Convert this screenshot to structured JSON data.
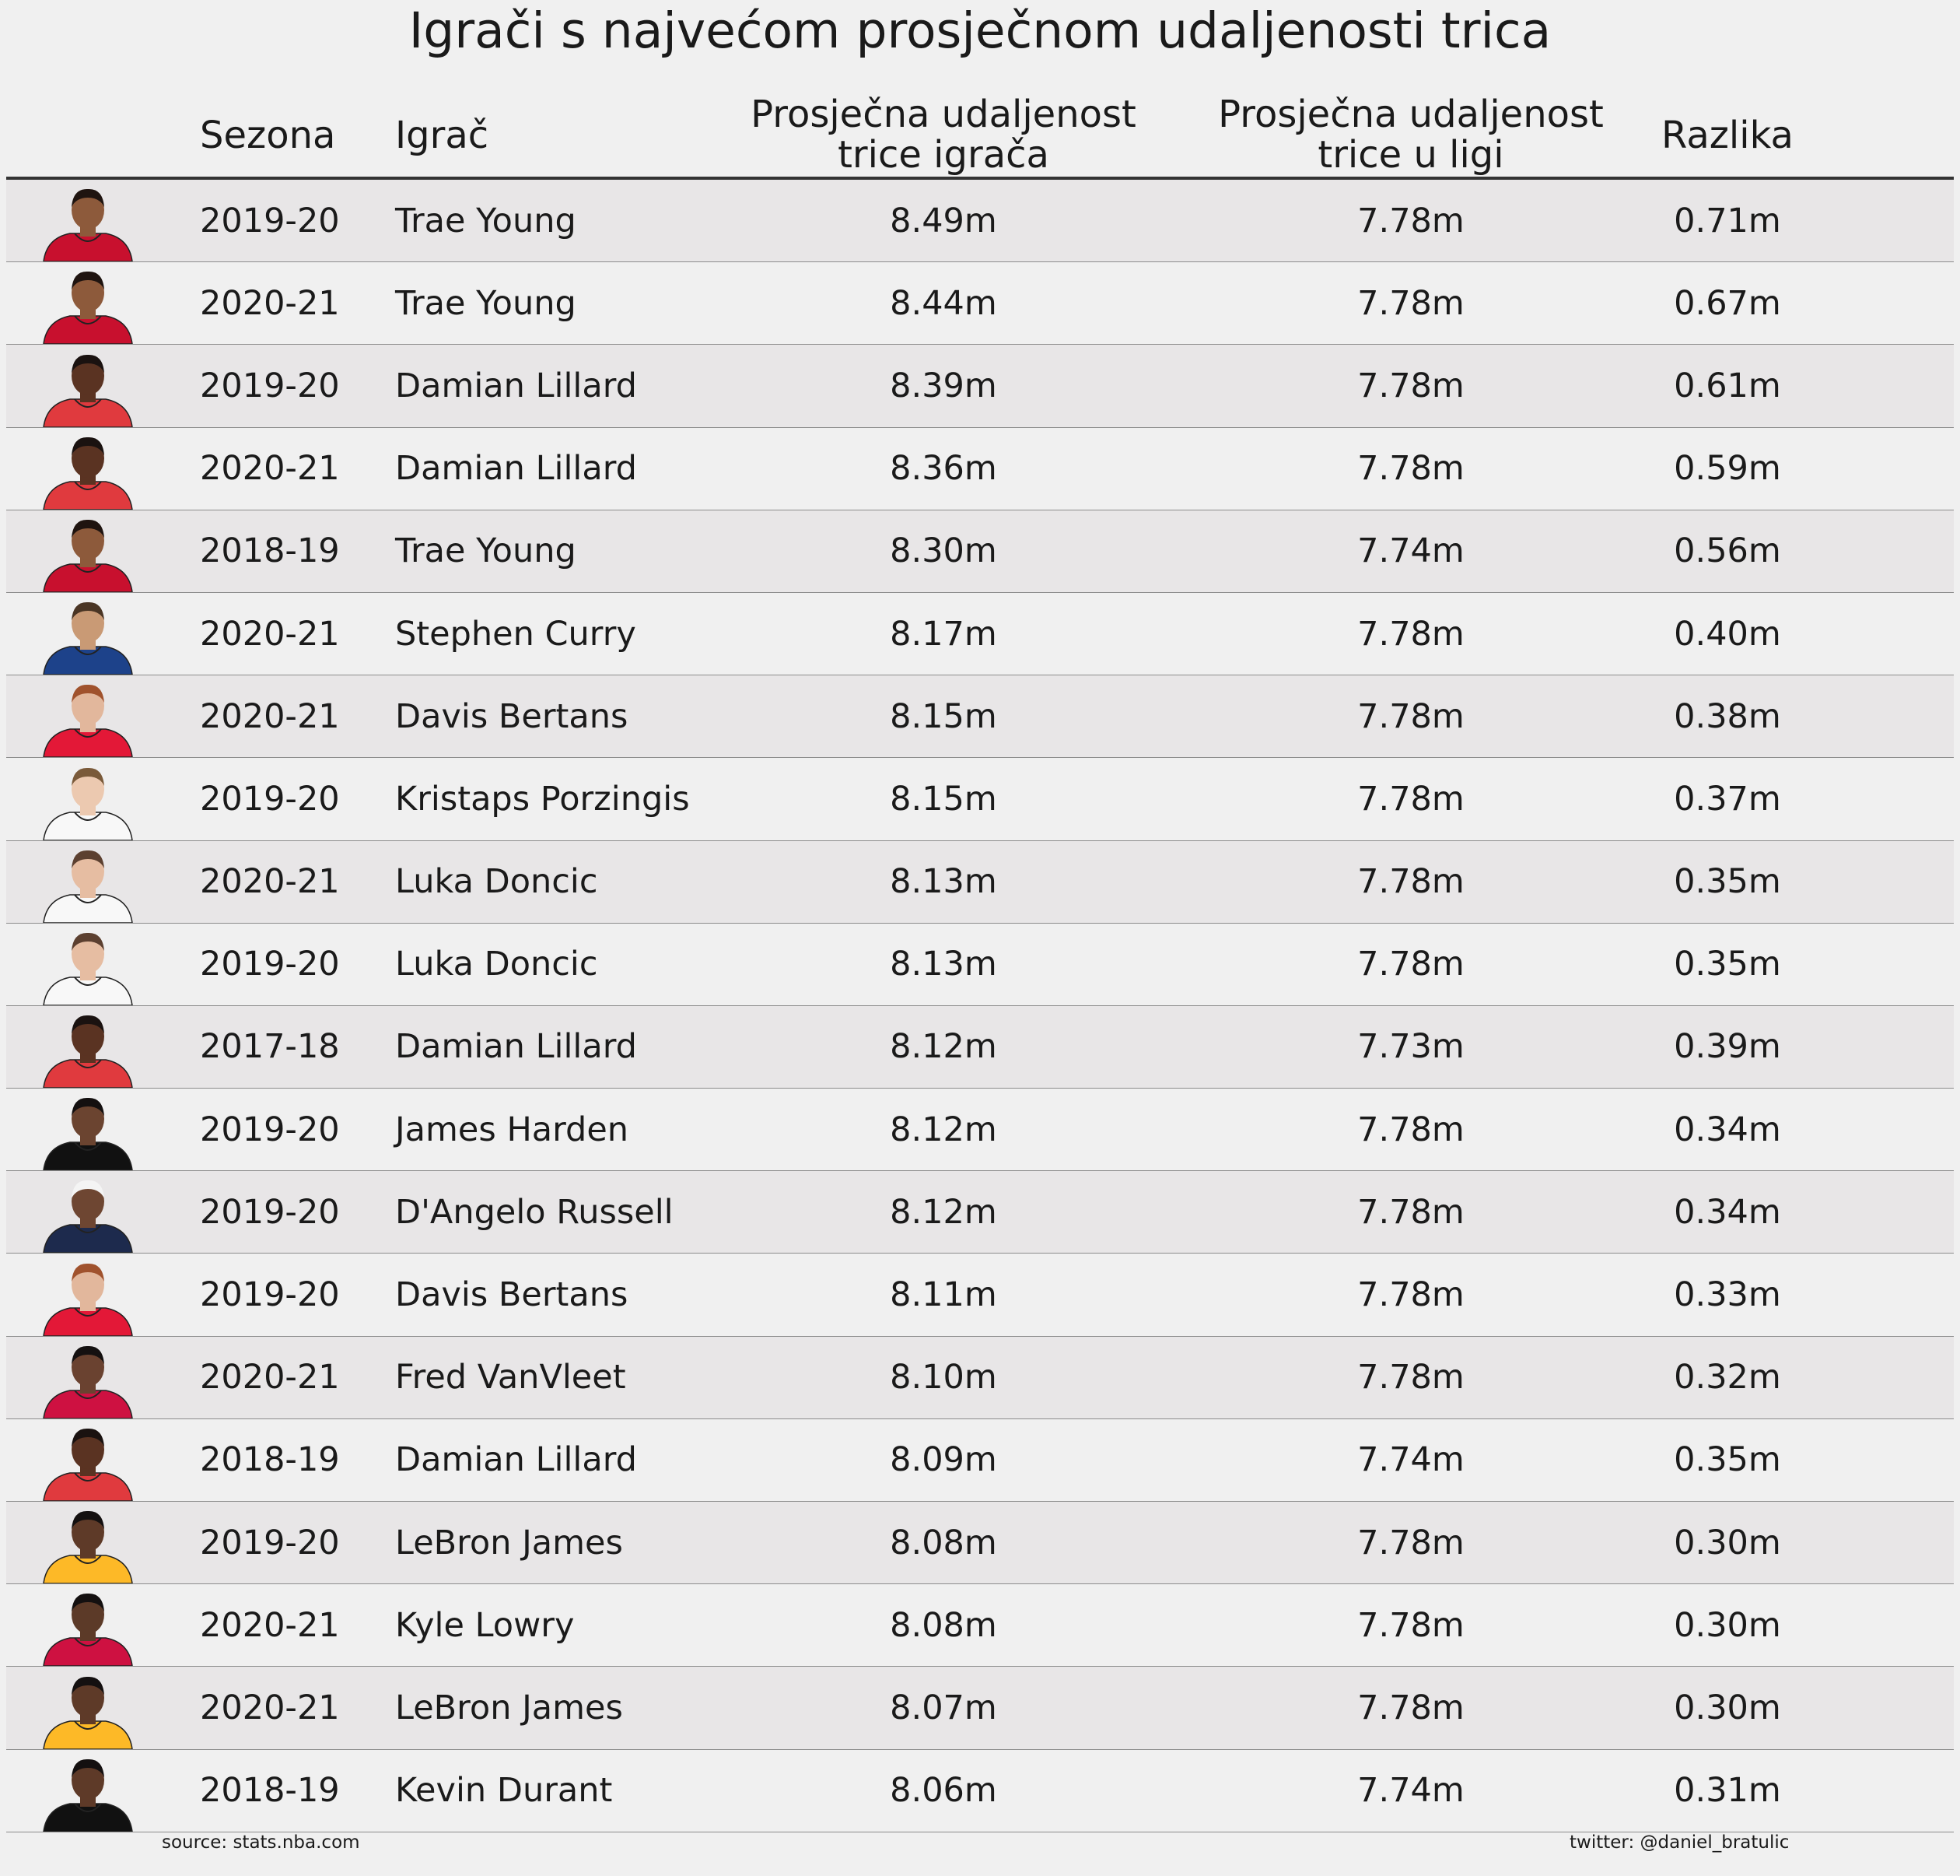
{
  "title": "Igrači s najvećom prosječnom udaljenosti trica",
  "headers": {
    "season": "Sezona",
    "player": "Igrač",
    "player_dist_line1": "Prosječna udaljenost",
    "player_dist_line2": "trice igrača",
    "league_dist_line1": "Prosječna udaljenost",
    "league_dist_line2": "trice u ligi",
    "diff": "Razlika"
  },
  "footer": {
    "source": "source: stats.nba.com",
    "twitter": "twitter: @daniel_bratulic"
  },
  "colors": {
    "background": "#f0f0f0",
    "row_shade": "#e8e6e7",
    "header_rule": "#333333",
    "row_rule": "#8c8c8c"
  },
  "chart_data": {
    "type": "table",
    "columns": [
      "Sezona",
      "Igrač",
      "Prosječna udaljenost trice igrača",
      "Prosječna udaljenost trice u ligi",
      "Razlika"
    ],
    "rows": [
      {
        "season": "2019-20",
        "player": "Trae Young",
        "player_dist": "8.49m",
        "league_dist": "7.78m",
        "diff": "0.71m",
        "jersey": "#c8102e",
        "skin": "#8d5a3b",
        "hair": "#1f1410"
      },
      {
        "season": "2020-21",
        "player": "Trae Young",
        "player_dist": "8.44m",
        "league_dist": "7.78m",
        "diff": "0.67m",
        "jersey": "#c8102e",
        "skin": "#8d5a3b",
        "hair": "#1f1410"
      },
      {
        "season": "2019-20",
        "player": "Damian Lillard",
        "player_dist": "8.39m",
        "league_dist": "7.78m",
        "diff": "0.61m",
        "jersey": "#e03a3e",
        "skin": "#5a3322",
        "hair": "#1a1210"
      },
      {
        "season": "2020-21",
        "player": "Damian Lillard",
        "player_dist": "8.36m",
        "league_dist": "7.78m",
        "diff": "0.59m",
        "jersey": "#e03a3e",
        "skin": "#5a3322",
        "hair": "#1a1210"
      },
      {
        "season": "2018-19",
        "player": "Trae Young",
        "player_dist": "8.30m",
        "league_dist": "7.74m",
        "diff": "0.56m",
        "jersey": "#c8102e",
        "skin": "#8d5a3b",
        "hair": "#1f1410"
      },
      {
        "season": "2020-21",
        "player": "Stephen Curry",
        "player_dist": "8.17m",
        "league_dist": "7.78m",
        "diff": "0.40m",
        "jersey": "#1d428a",
        "skin": "#c99a75",
        "hair": "#4a3524"
      },
      {
        "season": "2020-21",
        "player": "Davis Bertans",
        "player_dist": "8.15m",
        "league_dist": "7.78m",
        "diff": "0.38m",
        "jersey": "#e31837",
        "skin": "#e2b79c",
        "hair": "#a0522d"
      },
      {
        "season": "2019-20",
        "player": "Kristaps Porzingis",
        "player_dist": "8.15m",
        "league_dist": "7.78m",
        "diff": "0.37m",
        "jersey": "#f8f8f8",
        "skin": "#ecc9b0",
        "hair": "#7a5a3a"
      },
      {
        "season": "2020-21",
        "player": "Luka Doncic",
        "player_dist": "8.13m",
        "league_dist": "7.78m",
        "diff": "0.35m",
        "jersey": "#f8f8f8",
        "skin": "#e6bda2",
        "hair": "#5c4030"
      },
      {
        "season": "2019-20",
        "player": "Luka Doncic",
        "player_dist": "8.13m",
        "league_dist": "7.78m",
        "diff": "0.35m",
        "jersey": "#f8f8f8",
        "skin": "#e6bda2",
        "hair": "#5c4030"
      },
      {
        "season": "2017-18",
        "player": "Damian Lillard",
        "player_dist": "8.12m",
        "league_dist": "7.73m",
        "diff": "0.39m",
        "jersey": "#e03a3e",
        "skin": "#5a3322",
        "hair": "#1a1210"
      },
      {
        "season": "2019-20",
        "player": "James Harden",
        "player_dist": "8.12m",
        "league_dist": "7.78m",
        "diff": "0.34m",
        "jersey": "#111111",
        "skin": "#6b4430",
        "hair": "#141010"
      },
      {
        "season": "2019-20",
        "player": "D'Angelo Russell",
        "player_dist": "8.12m",
        "league_dist": "7.78m",
        "diff": "0.34m",
        "jersey": "#1d2a4d",
        "skin": "#6e4632",
        "hair": "#f4f4f4"
      },
      {
        "season": "2019-20",
        "player": "Davis Bertans",
        "player_dist": "8.11m",
        "league_dist": "7.78m",
        "diff": "0.33m",
        "jersey": "#e31837",
        "skin": "#e2b79c",
        "hair": "#a0522d"
      },
      {
        "season": "2020-21",
        "player": "Fred VanVleet",
        "player_dist": "8.10m",
        "league_dist": "7.78m",
        "diff": "0.32m",
        "jersey": "#ce1141",
        "skin": "#6a4230",
        "hair": "#141010"
      },
      {
        "season": "2018-19",
        "player": "Damian Lillard",
        "player_dist": "8.09m",
        "league_dist": "7.74m",
        "diff": "0.35m",
        "jersey": "#e03a3e",
        "skin": "#5a3322",
        "hair": "#1a1210"
      },
      {
        "season": "2019-20",
        "player": "LeBron James",
        "player_dist": "8.08m",
        "league_dist": "7.78m",
        "diff": "0.30m",
        "jersey": "#fdb927",
        "skin": "#5e3a28",
        "hair": "#141010"
      },
      {
        "season": "2020-21",
        "player": "Kyle Lowry",
        "player_dist": "8.08m",
        "league_dist": "7.78m",
        "diff": "0.30m",
        "jersey": "#ce1141",
        "skin": "#5c3a28",
        "hair": "#141010"
      },
      {
        "season": "2020-21",
        "player": "LeBron James",
        "player_dist": "8.07m",
        "league_dist": "7.78m",
        "diff": "0.30m",
        "jersey": "#fdb927",
        "skin": "#5e3a28",
        "hair": "#141010"
      },
      {
        "season": "2018-19",
        "player": "Kevin Durant",
        "player_dist": "8.06m",
        "league_dist": "7.74m",
        "diff": "0.31m",
        "jersey": "#111111",
        "skin": "#5e3a28",
        "hair": "#141010"
      }
    ]
  }
}
